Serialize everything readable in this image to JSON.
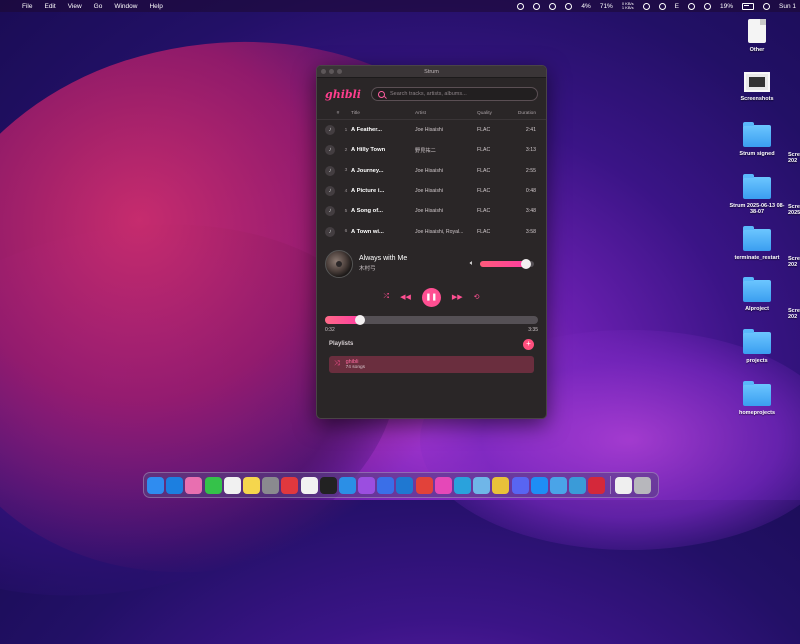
{
  "menubar": {
    "menus": [
      "File",
      "Edit",
      "View",
      "Go",
      "Window",
      "Help"
    ],
    "status": {
      "cpu": "4%",
      "mem": "71%",
      "net_up": "0 KB/s",
      "net_down": "1 KB/s",
      "letter": "E",
      "battery": "19%",
      "clock": "Sun 1"
    }
  },
  "desktop": {
    "items": [
      {
        "label": "Other",
        "kind": "doc"
      },
      {
        "label": "Screenshots",
        "kind": "screenshot"
      },
      {
        "label": "Strum signed",
        "kind": "folder"
      },
      {
        "label": "Strum 2025-06-13 08-38-07",
        "kind": "folder"
      },
      {
        "label": "terminate_restart",
        "kind": "folder"
      },
      {
        "label": "AIproject",
        "kind": "folder"
      },
      {
        "label": "projects",
        "kind": "folder"
      },
      {
        "label": "homeprojects",
        "kind": "folder"
      }
    ],
    "edge_labels": [
      "Scre\n202",
      "Scre\n2025",
      "Scre\n202",
      "Scre\n202"
    ]
  },
  "window": {
    "title": "Strum",
    "logo": "ghibli",
    "search_placeholder": "Search tracks, artists, albums...",
    "columns": {
      "num": "#",
      "title": "Title",
      "artist": "Artist",
      "quality": "Quality",
      "duration": "Duration"
    },
    "tracks": [
      {
        "num": "1",
        "title": "A Feather...",
        "artist": "Joe Hisaishi",
        "quality": "FLAC",
        "duration": "2:41"
      },
      {
        "num": "2",
        "title": "A Hilly Town",
        "artist": "野見祐二",
        "quality": "FLAC",
        "duration": "3:13"
      },
      {
        "num": "3",
        "title": "A Journey...",
        "artist": "Joe Hisaishi",
        "quality": "FLAC",
        "duration": "2:55"
      },
      {
        "num": "4",
        "title": "A Picture i...",
        "artist": "Joe Hisaishi",
        "quality": "FLAC",
        "duration": "0:48"
      },
      {
        "num": "5",
        "title": "A Song of...",
        "artist": "Joe Hisaishi",
        "quality": "FLAC",
        "duration": "3:48"
      },
      {
        "num": "6",
        "title": "A Town wi...",
        "artist": "Joe Hisaishi, Royal...",
        "quality": "FLAC",
        "duration": "3:58"
      }
    ],
    "now_playing": {
      "title": "Always with Me",
      "artist": "木村弓",
      "elapsed": "0:32",
      "total": "3:35",
      "progress_fraction": 0.165,
      "volume_fraction": 0.85
    },
    "playlists": {
      "label": "Playlists",
      "items": [
        {
          "name": "ghibli",
          "count": "74 songs"
        }
      ]
    }
  },
  "dock": {
    "apps": [
      {
        "icon": "finder-icon",
        "color": "#2f8cf0"
      },
      {
        "icon": "safari-icon",
        "color": "#1c7fe0"
      },
      {
        "icon": "photos-icon",
        "color": "#e86fb0"
      },
      {
        "icon": "messages-icon",
        "color": "#35c24a"
      },
      {
        "icon": "reminders-icon",
        "color": "#f1f1f1"
      },
      {
        "icon": "notes-icon",
        "color": "#f5d64d"
      },
      {
        "icon": "settings-icon",
        "color": "#8a8a8f"
      },
      {
        "icon": "music-record-icon",
        "color": "#e0383e"
      },
      {
        "icon": "notion-icon",
        "color": "#f2f2f2"
      },
      {
        "icon": "terminal-icon",
        "color": "#222222"
      },
      {
        "icon": "docker-icon",
        "color": "#2b8fe6"
      },
      {
        "icon": "podcasts-icon",
        "color": "#9b4ee0"
      },
      {
        "icon": "xcode-store-icon",
        "color": "#3a6fe8"
      },
      {
        "icon": "vscode-icon",
        "color": "#1f78d1"
      },
      {
        "icon": "intellij-icon",
        "color": "#e2423a"
      },
      {
        "icon": "strum-icon",
        "color": "#e548b8"
      },
      {
        "icon": "telegram-icon",
        "color": "#2aa2dc"
      },
      {
        "icon": "preview-icon",
        "color": "#6fb6e8"
      },
      {
        "icon": "chrome-icon",
        "color": "#e9c13a"
      },
      {
        "icon": "discord-icon",
        "color": "#5865f2"
      },
      {
        "icon": "appstore-icon",
        "color": "#1e8ef5"
      },
      {
        "icon": "photo-browser-icon",
        "color": "#4aa4e8"
      },
      {
        "icon": "pen-app-icon",
        "color": "#3a9bd8"
      },
      {
        "icon": "red-app-icon",
        "color": "#d4283a"
      },
      {
        "icon": "document-icon",
        "color": "#efefef"
      },
      {
        "icon": "trash-icon",
        "color": "#b7b7bc"
      }
    ]
  }
}
